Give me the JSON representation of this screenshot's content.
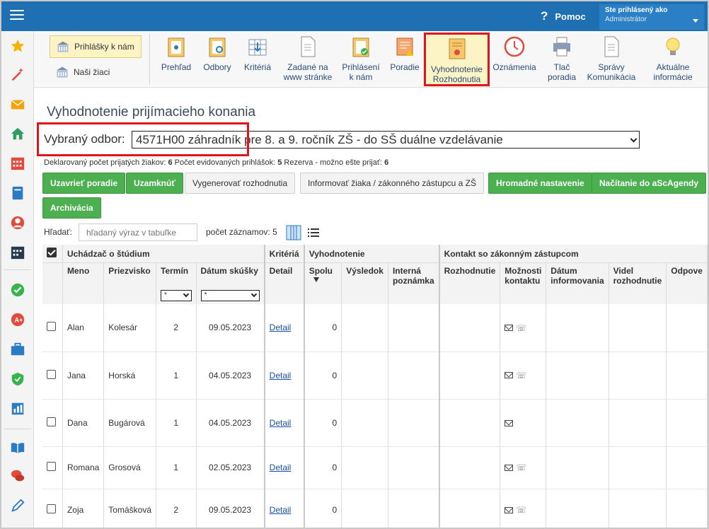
{
  "topbar": {
    "help_label": "Pomoc",
    "user_line1": "Ste prihlásený ako",
    "user_line2": "Administrátor"
  },
  "toolbar": {
    "left_buttons": [
      "Prihlášky k nám",
      "Naši žiaci"
    ],
    "tools": [
      "Prehľad",
      "Odbory",
      "Kritériá",
      "Zadané na\nwww stránke",
      "Prihlásení\nk nám",
      "Poradie",
      "Vyhodnotenie\nRozhodnutia",
      "Oznámenia",
      "Tlač\nporadia",
      "Správy\nKomunikácia",
      "Aktuálne\ninformácie"
    ],
    "active_tool": "Vyhodnotenie Rozhodnutia"
  },
  "page": {
    "title": "Vyhodnotenie prijímacieho konania",
    "odbor_label": "Vybraný odbor:",
    "odbor_value": "4571H00 záhradník pre 8. a 9. ročník ZŠ - do SŠ duálne vzdelávanie",
    "stats": {
      "declared_label": "Deklarovaný počet prijatých žiakov:",
      "declared_value": "6",
      "registered_label": "Počet evidovaných prihlášok:",
      "registered_value": "5",
      "reserve_label": "Rezerva - možno ešte prijať:",
      "reserve_value": "6"
    },
    "buttons": {
      "close_order": "Uzavrieť poradie",
      "lock": "Uzamknúť",
      "generate": "Vygenerovať rozhodnutia",
      "inform": "Informovať žiaka / zákonného zástupcu a ZŠ",
      "bulk": "Hromadné nastavenie",
      "import": "Načítanie do aScAgendy",
      "archive": "Archivácia"
    },
    "search_label": "Hľadať:",
    "search_placeholder": "hľadaný výraz v tabuľke",
    "count_label": "počet záznamov:",
    "count_value": "5"
  },
  "table": {
    "groups": {
      "applicant": "Uchádzač o štúdium",
      "criteria": "Kritériá",
      "evaluation": "Vyhodnotenie",
      "contact": "Kontakt so zákonným zástupcom"
    },
    "columns": {
      "first_name": "Meno",
      "last_name": "Priezvisko",
      "term": "Termín",
      "exam_date": "Dátum skúšky",
      "detail": "Detail",
      "total": "Spolu",
      "result": "Výsledok",
      "internal_note": "Interná poznámka",
      "decision": "Rozhodnutie",
      "contact_options": "Možnosti kontaktu",
      "inform_date": "Dátum informovania",
      "saw_decision": "Videl rozhodnutie",
      "response": "Odpove"
    },
    "filters": {
      "term": "*",
      "exam_date": "*"
    },
    "detail_link": "Detail",
    "rows": [
      {
        "first": "Alan",
        "last": "Kolesár",
        "term": "2",
        "date": "09.05.2023",
        "total": "0",
        "mail": true,
        "phone": true
      },
      {
        "first": "Jana",
        "last": "Horská",
        "term": "1",
        "date": "04.05.2023",
        "total": "0",
        "mail": true,
        "phone": true
      },
      {
        "first": "Dana",
        "last": "Bugárová",
        "term": "1",
        "date": "04.05.2023",
        "total": "0",
        "mail": true,
        "phone": false
      },
      {
        "first": "Romana",
        "last": "Grosová",
        "term": "1",
        "date": "02.05.2023",
        "total": "0",
        "mail": true,
        "phone": true
      },
      {
        "first": "Zoja",
        "last": "Tomášková",
        "term": "2",
        "date": "09.05.2023",
        "total": "0",
        "mail": true,
        "phone": true
      }
    ]
  },
  "colors": {
    "topbar": "#1f6fb3",
    "green_button": "#4caf50",
    "highlight_red": "#e0151c",
    "link": "#1a4fa3"
  },
  "sidebar_icons": [
    "star-icon",
    "magic-wand-icon",
    "mail-icon",
    "home-icon",
    "calendar-icon",
    "book-icon",
    "user-icon",
    "schedule-icon",
    "check-icon",
    "grade-icon",
    "briefcase-icon",
    "shield-icon",
    "chart-icon",
    "open-book-icon",
    "chat-icon",
    "pen-icon"
  ]
}
